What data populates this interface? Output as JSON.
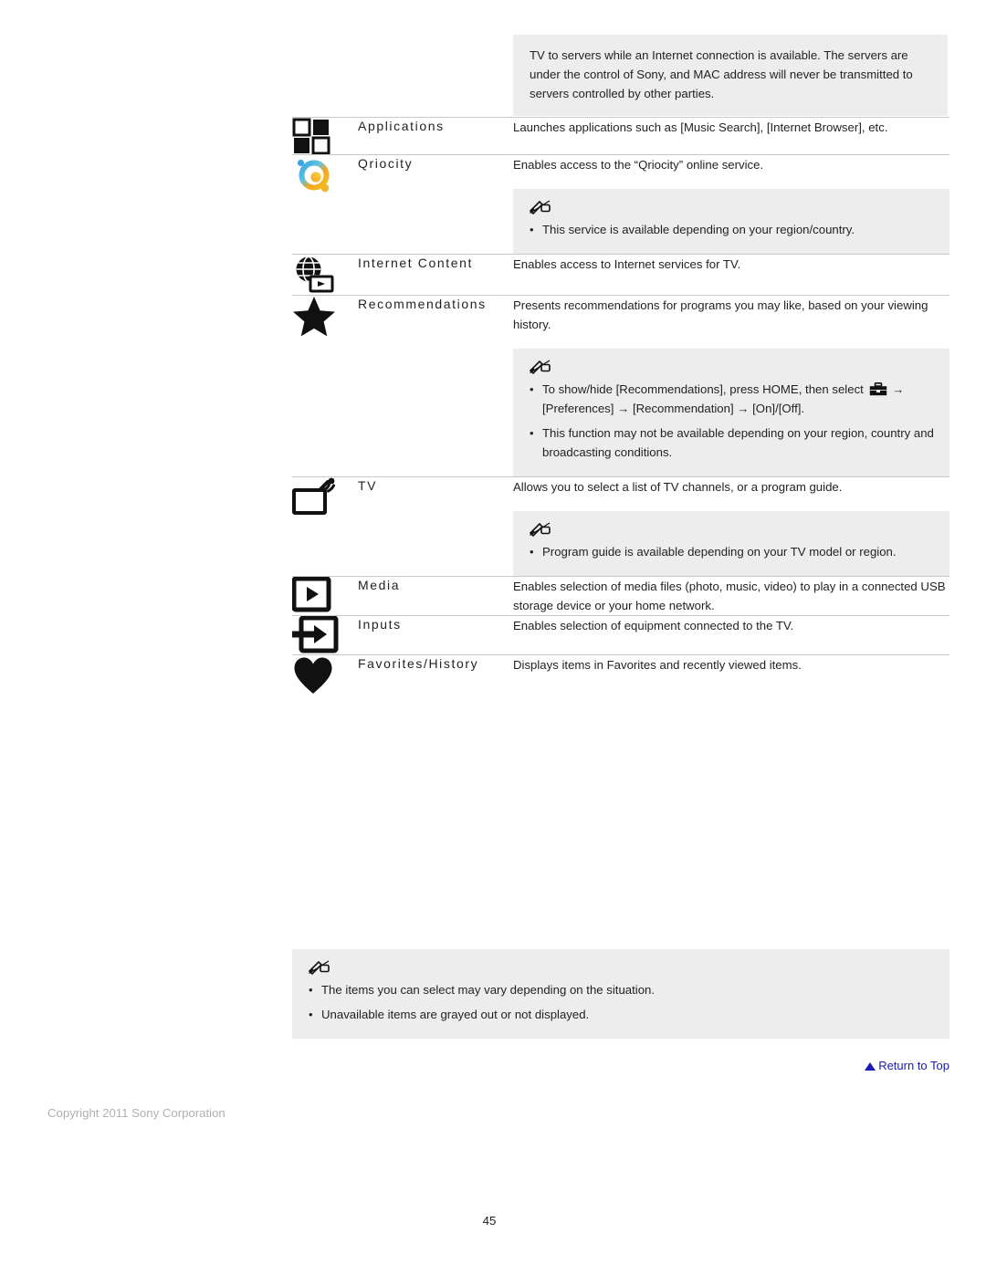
{
  "top_note": {
    "text": "TV to servers while an Internet connection is available. The servers are under the control of Sony, and MAC address will never be transmitted to servers controlled by other parties."
  },
  "rows": [
    {
      "icon": "applications-grid-icon",
      "label": "Applications",
      "description": "Launches applications such as [Music Search], [Internet Browser], etc.",
      "note": null
    },
    {
      "icon": "qriocity-icon",
      "label": "Qriocity",
      "description": "Enables access to the “Qriocity” online service.",
      "note": {
        "items": [
          "This service is available depending on your region/country."
        ]
      }
    },
    {
      "icon": "internet-content-globe-icon",
      "label": "Internet Content",
      "description": "Enables access to Internet services for TV.",
      "note": null
    },
    {
      "icon": "recommendations-star-icon",
      "label": "Recommendations",
      "description": "Presents recommendations for programs you may like, based on your viewing history.",
      "note": {
        "items": [
          "This function may not be available depending on your region, country and broadcasting conditions."
        ],
        "rich_first_item": {
          "part1": "To show/hide [Recommendations], press HOME, then select ",
          "icon": "toolbox-icon",
          "part2": " → [Preferences] → [Recommendation] → [On]/[Off]."
        }
      }
    },
    {
      "icon": "tv-signal-icon",
      "label": "TV",
      "description": "Allows you to select a list of TV channels, or a program guide.",
      "note": {
        "items": [
          "Program guide is available depending on your TV model or region."
        ]
      }
    },
    {
      "icon": "media-play-icon",
      "label": "Media",
      "description": "Enables selection of media files (photo, music, video) to play in a connected USB storage device or your home network.",
      "note": null
    },
    {
      "icon": "inputs-arrow-icon",
      "label": "Inputs",
      "description": "Enables selection of equipment connected to the TV.",
      "note": null
    },
    {
      "icon": "favorites-heart-icon",
      "label": "Favorites/History",
      "description": "Displays items in Favorites and recently viewed items.",
      "note": null
    }
  ],
  "bottom_note": {
    "icon": "note-pen-icon",
    "items": [
      "The items you can select may vary depending on the situation.",
      "Unavailable items are grayed out or not displayed."
    ]
  },
  "footer": {
    "return_to_top": "Return to Top",
    "return_to_top_icon": "triangle-up-icon",
    "copyright": "Copyright 2011 Sony Corporation",
    "page_number": "45"
  },
  "colors": {
    "note_background": "#ededed",
    "rule": "#c9c9c9",
    "link": "#1a1ab4",
    "copyright": "#b0b0b0",
    "text": "#231f20"
  }
}
